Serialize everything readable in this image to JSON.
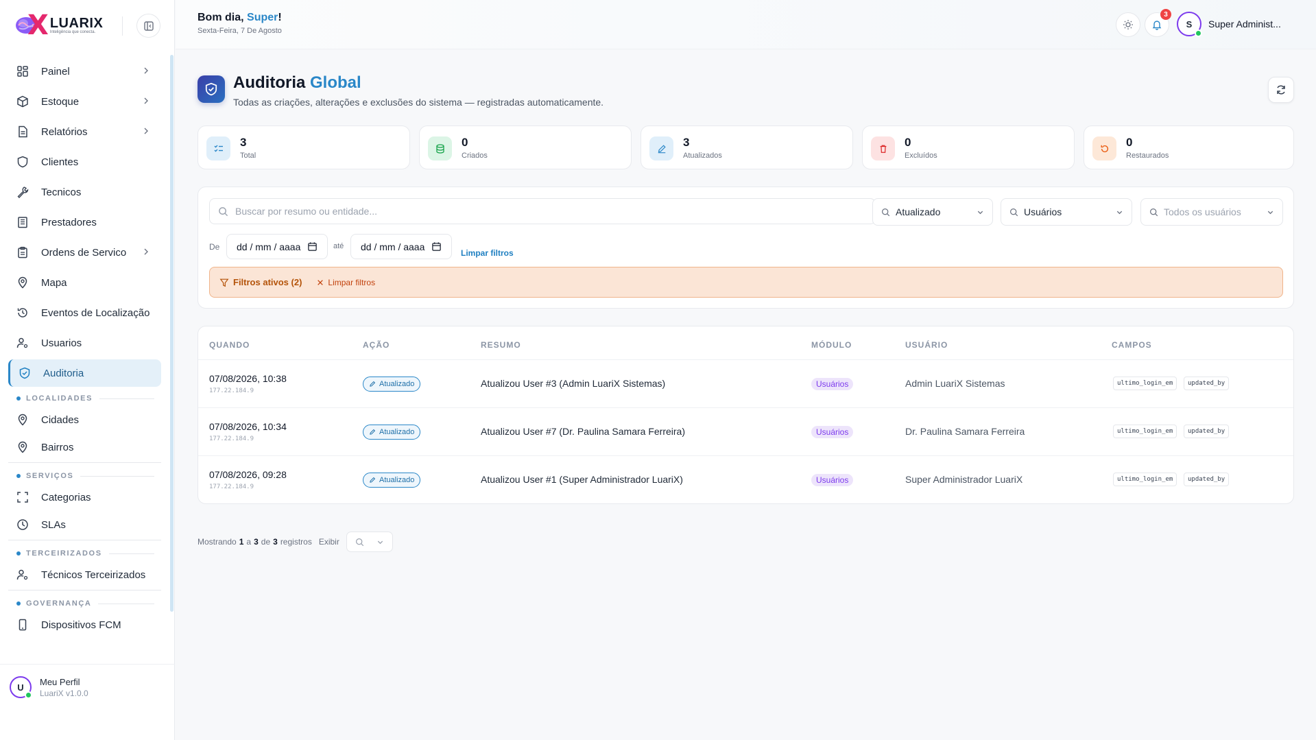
{
  "brand": {
    "name": "LUARIX",
    "tagline": "Inteligência que conecta."
  },
  "header": {
    "greeting_prefix": "Bom dia, ",
    "greeting_name": "Super",
    "greeting_suffix": "!",
    "date": "Sexta-Feira, 7 De Agosto",
    "notifications_count": "3",
    "user_initial": "S",
    "user_name": "Super Administ..."
  },
  "sidebar": {
    "items": [
      {
        "label": "Painel"
      },
      {
        "label": "Estoque"
      },
      {
        "label": "Relatórios"
      },
      {
        "label": "Clientes"
      },
      {
        "label": "Tecnicos"
      },
      {
        "label": "Prestadores"
      },
      {
        "label": "Ordens de Servico"
      },
      {
        "label": "Mapa"
      },
      {
        "label": "Eventos de Localização"
      },
      {
        "label": "Usuarios"
      },
      {
        "label": "Auditoria"
      }
    ],
    "sections": [
      {
        "title": "LOCALIDADES",
        "items": [
          "Cidades",
          "Bairros"
        ]
      },
      {
        "title": "SERVIÇOS",
        "items": [
          "Categorias",
          "SLAs"
        ]
      },
      {
        "title": "TERCEIRIZADOS",
        "items": [
          "Técnicos Terceirizados"
        ]
      },
      {
        "title": "GOVERNANÇA",
        "items": [
          "Dispositivos FCM"
        ]
      }
    ],
    "profile": {
      "initial": "U",
      "label": "Meu Perfil",
      "version": "LuariX v1.0.0"
    }
  },
  "page": {
    "title_main": "Auditoria ",
    "title_accent": "Global",
    "subtitle": "Todas as criações, alterações e exclusões do sistema — registradas automaticamente."
  },
  "stats": [
    {
      "value": "3",
      "label": "Total",
      "color": "#2a87c8"
    },
    {
      "value": "0",
      "label": "Criados",
      "color": "#16a34a"
    },
    {
      "value": "3",
      "label": "Atualizados",
      "color": "#2a87c8"
    },
    {
      "value": "0",
      "label": "Excluídos",
      "color": "#dc2626"
    },
    {
      "value": "0",
      "label": "Restaurados",
      "color": "#ea580c"
    }
  ],
  "filters": {
    "search_placeholder": "Buscar por resumo ou entidade...",
    "action_value": "Atualizado",
    "module_value": "Usuários",
    "user_placeholder": "Todos os usuários",
    "from_label": "De",
    "to_label": "até",
    "date_placeholder": "dd / mm / aaaa",
    "clear_label": "Limpar filtros",
    "active_label": "Filtros ativos (2)",
    "active_clear_label": "Limpar filtros"
  },
  "table": {
    "headers": [
      "QUANDO",
      "AÇÃO",
      "RESUMO",
      "MÓDULO",
      "USUÁRIO",
      "CAMPOS"
    ],
    "rows": [
      {
        "when": "07/08/2026, 10:38",
        "ip": "177.22.184.9",
        "action": "Atualizado",
        "summary": "Atualizou User #3 (Admin LuariX Sistemas)",
        "module": "Usuários",
        "user": "Admin LuariX Sistemas",
        "fields": [
          "ultimo_login_em",
          "updated_by"
        ]
      },
      {
        "when": "07/08/2026, 10:34",
        "ip": "177.22.184.9",
        "action": "Atualizado",
        "summary": "Atualizou User #7 (Dr. Paulina Samara Ferreira)",
        "module": "Usuários",
        "user": "Dr. Paulina Samara Ferreira",
        "fields": [
          "ultimo_login_em",
          "updated_by"
        ]
      },
      {
        "when": "07/08/2026, 09:28",
        "ip": "177.22.184.9",
        "action": "Atualizado",
        "summary": "Atualizou User #1 (Super Administrador LuariX)",
        "module": "Usuários",
        "user": "Super Administrador LuariX",
        "fields": [
          "ultimo_login_em",
          "updated_by"
        ]
      }
    ]
  },
  "pagination": {
    "prefix": "Mostrando",
    "from": "1",
    "a": "a",
    "to": "3",
    "de": "de",
    "total": "3",
    "suffix": "registros",
    "show_label": "Exibir"
  }
}
